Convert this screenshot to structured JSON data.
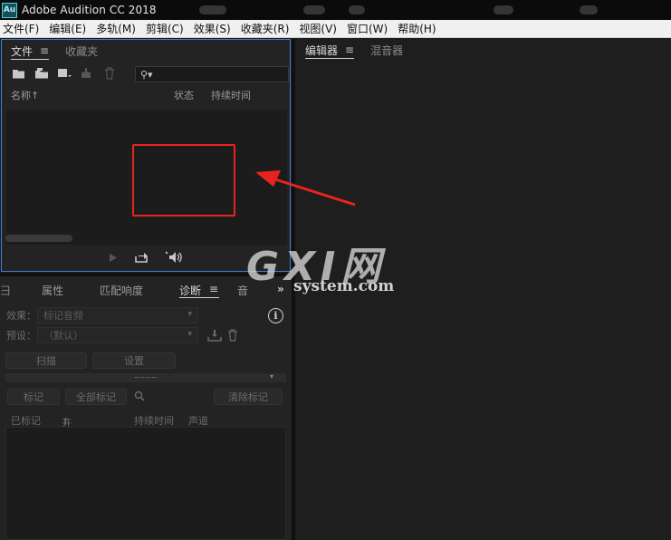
{
  "window": {
    "app_icon_text": "Au",
    "title": "Adobe Audition CC 2018"
  },
  "menu": [
    {
      "label": "文件(F)"
    },
    {
      "label": "编辑(E)"
    },
    {
      "label": "多轨(M)"
    },
    {
      "label": "剪辑(C)"
    },
    {
      "label": "效果(S)"
    },
    {
      "label": "收藏夹(R)"
    },
    {
      "label": "视图(V)"
    },
    {
      "label": "窗口(W)"
    },
    {
      "label": "帮助(H)"
    }
  ],
  "file_panel": {
    "tabs": [
      {
        "label": "文件",
        "active": true
      },
      {
        "label": "收藏夹",
        "active": false
      }
    ],
    "menu_glyph": "≡",
    "search_glyph": "⚲▾",
    "columns": {
      "name": "名称",
      "name_sort": "↑",
      "status": "状态",
      "duration": "持续时间"
    }
  },
  "editor_panel": {
    "tabs": [
      {
        "label": "编辑器",
        "active": true
      },
      {
        "label": "混音器",
        "active": false
      }
    ],
    "menu_glyph": "≡"
  },
  "diagnostics_panel": {
    "left_edge_glyph": "彐",
    "tabs": [
      {
        "label": "属性",
        "active": false
      },
      {
        "label": "匹配响度",
        "active": false
      },
      {
        "label": "诊断",
        "active": true
      },
      {
        "label": "音",
        "active": false
      }
    ],
    "overflow_glyph": "»",
    "menu_glyph": "≡",
    "info_glyph": "i",
    "effect_label": "效果：",
    "effect_value": "标记音频",
    "preset_label": "预设：",
    "preset_value": "（默认）",
    "scan_button": "扫描",
    "settings_button": "设置",
    "mark_button": "标记",
    "mark_all_button": "全部标记",
    "clear_marks_button": "清除标记",
    "list_columns": {
      "marked": "已标记",
      "start": "开始",
      "start_sort": "↑",
      "duration": "持续时间",
      "channel": "声道"
    }
  },
  "watermark": {
    "logo": "GXI网",
    "site": "system.com"
  },
  "colors": {
    "accent_blue": "#3d7fd1",
    "annotation_red": "#e8231f",
    "panel_bg": "#232323",
    "menu_bg": "#f0f0f0"
  }
}
